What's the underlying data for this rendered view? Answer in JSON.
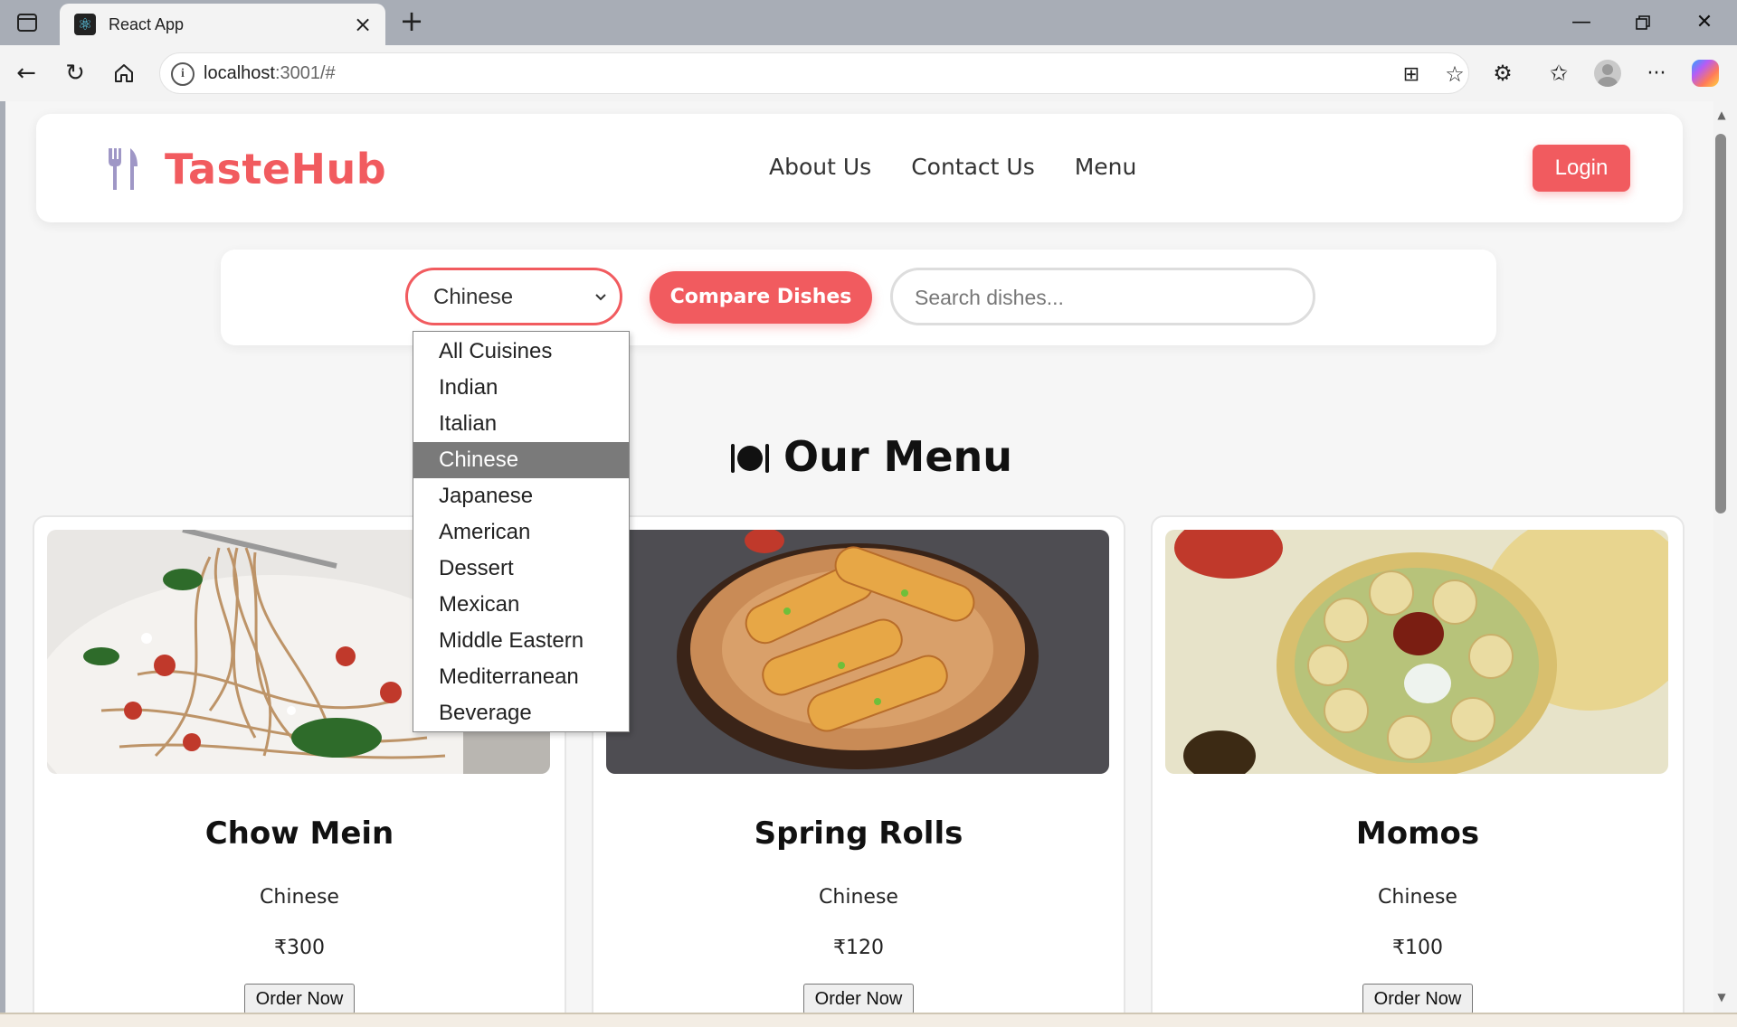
{
  "browser": {
    "tab_title": "React App",
    "url_host": "localhost",
    "url_rest": ":3001/#"
  },
  "site": {
    "brand": "TasteHub",
    "nav": [
      "About Us",
      "Contact Us",
      "Menu"
    ],
    "login_label": "Login"
  },
  "filters": {
    "selected_cuisine": "Chinese",
    "compare_label": "Compare Dishes",
    "search_placeholder": "Search dishes...",
    "options": [
      "All Cuisines",
      "Indian",
      "Italian",
      "Chinese",
      "Japanese",
      "American",
      "Dessert",
      "Mexican",
      "Middle Eastern",
      "Mediterranean",
      "Beverage"
    ]
  },
  "menu": {
    "title": "Our Menu",
    "dishes": [
      {
        "name": "Chow Mein",
        "cuisine": "Chinese",
        "price": "₹300",
        "cta": "Order Now"
      },
      {
        "name": "Spring Rolls",
        "cuisine": "Chinese",
        "price": "₹120",
        "cta": "Order Now"
      },
      {
        "name": "Momos",
        "cuisine": "Chinese",
        "price": "₹100",
        "cta": "Order Now"
      }
    ]
  },
  "colors": {
    "brand": "#f15b5f",
    "logo_icon": "#9f97c6"
  }
}
